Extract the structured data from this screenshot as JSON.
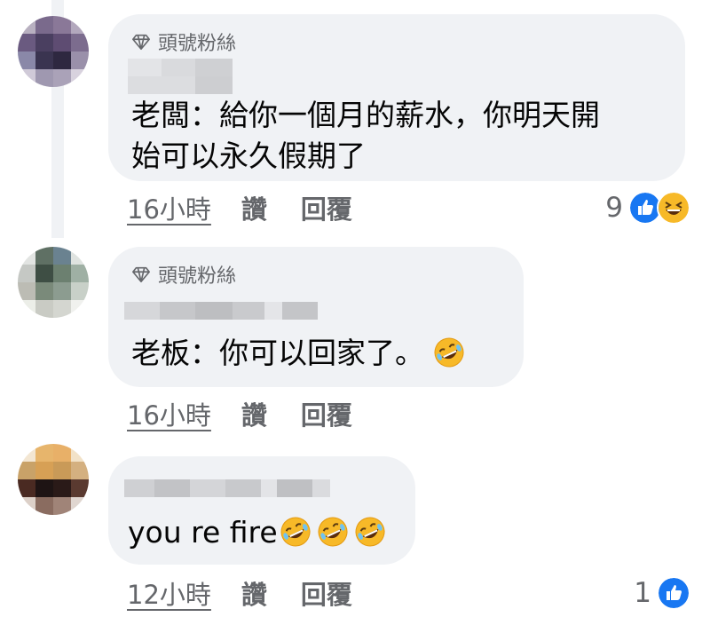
{
  "comments": [
    {
      "badge": "頭號粉絲",
      "text_lines": [
        "老闆：給你一個月的薪水，你明天開",
        "始可以永久假期了"
      ],
      "time": "16小時",
      "like_label": "讚",
      "reply_label": "回覆",
      "reaction_count": "9",
      "reactions": [
        "like-reaction-icon",
        "haha-reaction-icon"
      ]
    },
    {
      "badge": "頭號粉絲",
      "text": "老板：你可以回家了。",
      "emojis": [
        "rolling-on-floor-laughing-emoji"
      ],
      "time": "16小時",
      "like_label": "讚",
      "reply_label": "回覆"
    },
    {
      "text": "you re fire",
      "emojis": [
        "rolling-on-floor-laughing-emoji",
        "rolling-on-floor-laughing-emoji",
        "rolling-on-floor-laughing-emoji"
      ],
      "time": "12小時",
      "like_label": "讚",
      "reply_label": "回覆",
      "reaction_count": "1",
      "reactions": [
        "like-reaction-icon"
      ]
    }
  ],
  "colors": {
    "bubble": "#f0f2f5",
    "secondary_text": "#65676b",
    "like_blue": "#1877f2",
    "haha_yellow": "#f7b928"
  }
}
